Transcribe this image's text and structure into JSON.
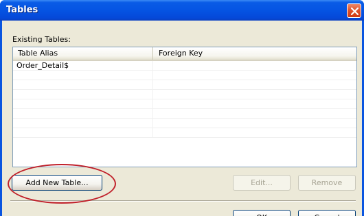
{
  "window": {
    "title": "Tables"
  },
  "existing_tables_label": "Existing Tables:",
  "table": {
    "columns": [
      "Table Alias",
      "Foreign Key"
    ],
    "rows": [
      [
        "Order_Detail$",
        ""
      ],
      [
        "",
        ""
      ],
      [
        "",
        ""
      ],
      [
        "",
        ""
      ],
      [
        "",
        ""
      ],
      [
        "",
        ""
      ],
      [
        "",
        ""
      ],
      [
        "",
        ""
      ]
    ]
  },
  "buttons": {
    "add_new_table": "Add New Table...",
    "edit": "Edit...",
    "remove": "Remove",
    "ok": "OK",
    "cancel": "Cancel"
  },
  "annotation": {
    "color": "#c0202a"
  },
  "icons": {
    "close": "close-icon"
  }
}
